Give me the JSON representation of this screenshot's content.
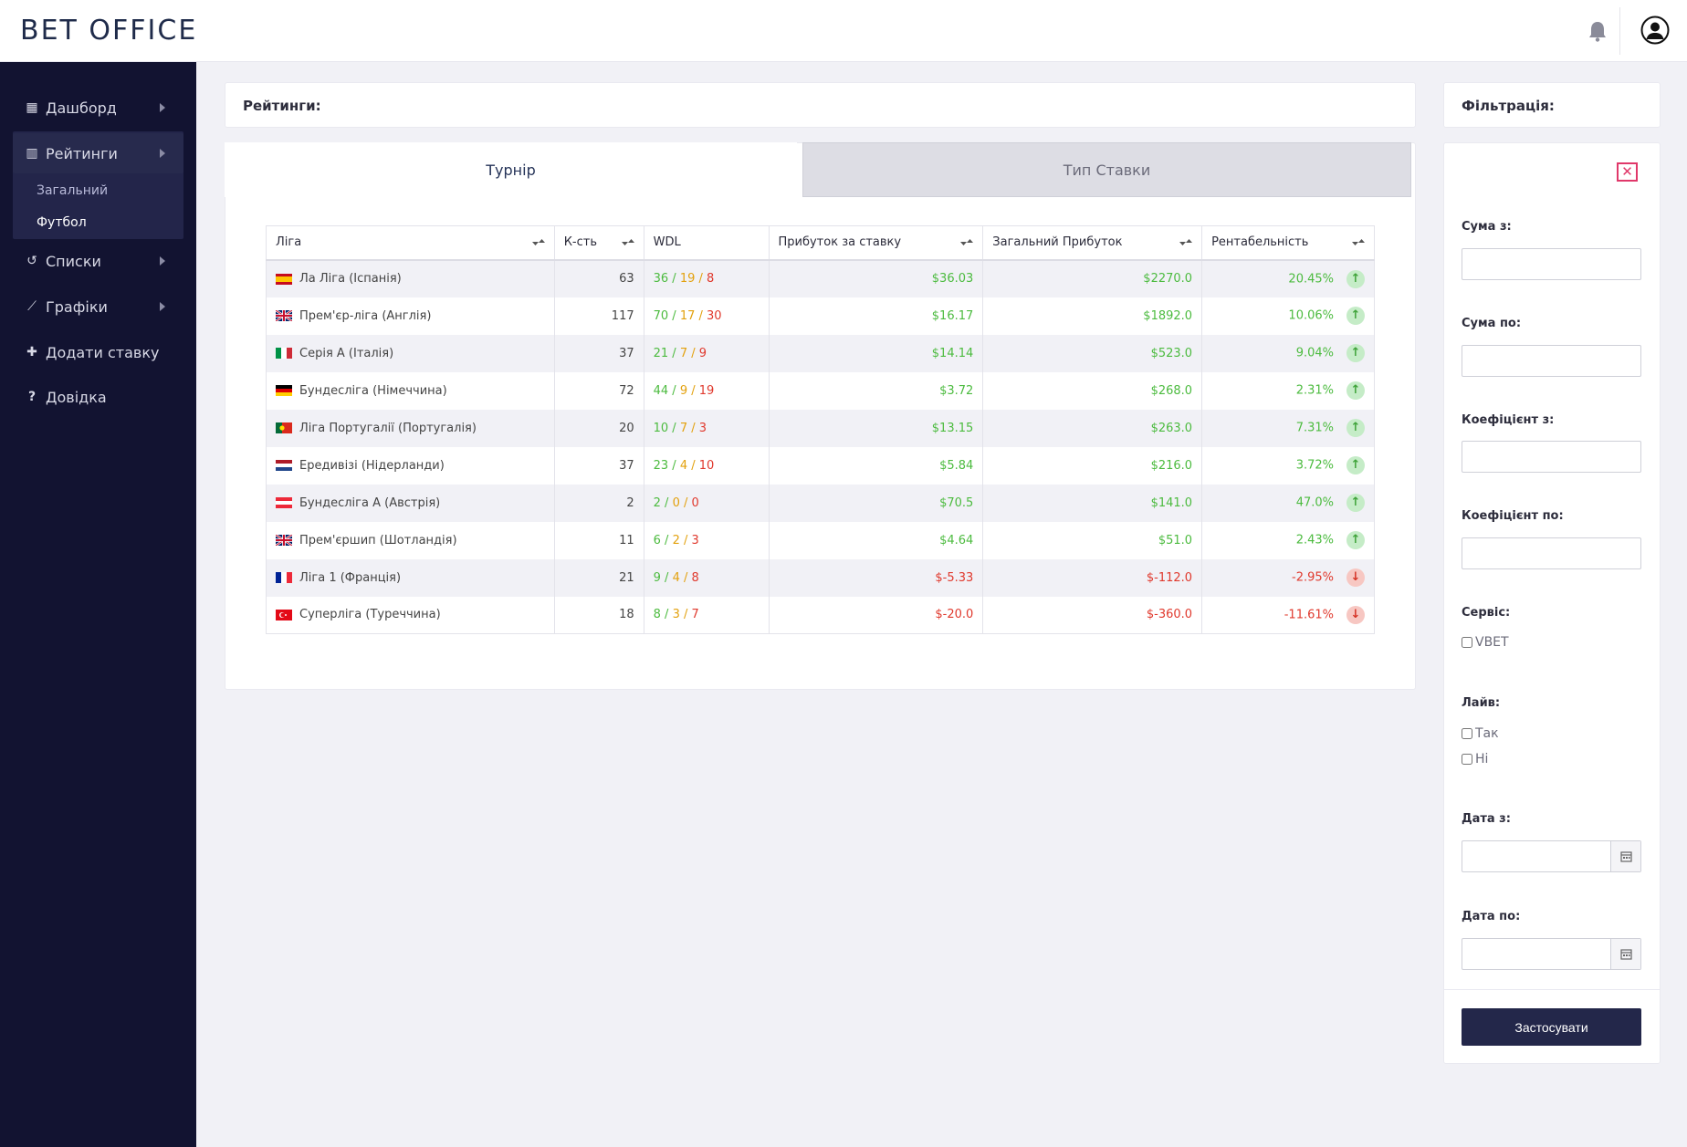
{
  "brand": "BET OFFICE",
  "sidebar": {
    "items": [
      {
        "label": "Дашборд",
        "icon": "dashboard-icon"
      },
      {
        "label": "Рейтинги",
        "icon": "bar-chart-icon"
      },
      {
        "label": "Списки",
        "icon": "history-icon"
      },
      {
        "label": "Графіки",
        "icon": "line-chart-icon"
      },
      {
        "label": "Додати ставку",
        "icon": "plus-icon"
      },
      {
        "label": "Довідка",
        "icon": "question-icon"
      }
    ],
    "sub_items": [
      "Загальний",
      "Футбол"
    ]
  },
  "ratings": {
    "title": "Рейтинги:",
    "tabs": [
      "Турнір",
      "Тип Ставки"
    ],
    "columns": [
      "Ліга",
      "К-сть",
      "WDL",
      "Прибуток за ставку",
      "Загальний Прибуток",
      "Рентабельність"
    ],
    "rows": [
      {
        "league": "Ла Ліга (Іспанія)",
        "flag": "es",
        "count": "63",
        "w": "36",
        "d": "19",
        "l": "8",
        "per_bet": "$36.03",
        "total": "$2270.0",
        "roi": "20.45%",
        "trend": "up"
      },
      {
        "league": "Прем'єр-ліга (Англія)",
        "flag": "gb",
        "count": "117",
        "w": "70",
        "d": "17",
        "l": "30",
        "per_bet": "$16.17",
        "total": "$1892.0",
        "roi": "10.06%",
        "trend": "up"
      },
      {
        "league": "Серія А (Італія)",
        "flag": "it",
        "count": "37",
        "w": "21",
        "d": "7",
        "l": "9",
        "per_bet": "$14.14",
        "total": "$523.0",
        "roi": "9.04%",
        "trend": "up"
      },
      {
        "league": "Бундесліга (Німеччина)",
        "flag": "de",
        "count": "72",
        "w": "44",
        "d": "9",
        "l": "19",
        "per_bet": "$3.72",
        "total": "$268.0",
        "roi": "2.31%",
        "trend": "up"
      },
      {
        "league": "Ліга Португалії (Португалія)",
        "flag": "pt",
        "count": "20",
        "w": "10",
        "d": "7",
        "l": "3",
        "per_bet": "$13.15",
        "total": "$263.0",
        "roi": "7.31%",
        "trend": "up"
      },
      {
        "league": "Ередивізі (Нідерланди)",
        "flag": "nl",
        "count": "37",
        "w": "23",
        "d": "4",
        "l": "10",
        "per_bet": "$5.84",
        "total": "$216.0",
        "roi": "3.72%",
        "trend": "up"
      },
      {
        "league": "Бундесліга А (Австрія)",
        "flag": "at",
        "count": "2",
        "w": "2",
        "d": "0",
        "l": "0",
        "per_bet": "$70.5",
        "total": "$141.0",
        "roi": "47.0%",
        "trend": "up"
      },
      {
        "league": "Прем'єршип (Шотландія)",
        "flag": "gb",
        "count": "11",
        "w": "6",
        "d": "2",
        "l": "3",
        "per_bet": "$4.64",
        "total": "$51.0",
        "roi": "2.43%",
        "trend": "up"
      },
      {
        "league": "Ліга 1 (Франція)",
        "flag": "fr",
        "count": "21",
        "w": "9",
        "d": "4",
        "l": "8",
        "per_bet": "$-5.33",
        "total": "$-112.0",
        "roi": "-2.95%",
        "trend": "down"
      },
      {
        "league": "Суперліга (Туреччина)",
        "flag": "tr",
        "count": "18",
        "w": "8",
        "d": "3",
        "l": "7",
        "per_bet": "$-20.0",
        "total": "$-360.0",
        "roi": "-11.61%",
        "trend": "down"
      }
    ]
  },
  "filter": {
    "title": "Фільтрація:",
    "sum_from": "Сума з:",
    "sum_to": "Сума по:",
    "coef_from": "Коефіцієнт з:",
    "coef_to": "Коефіцієнт по:",
    "service": "Сервіс:",
    "service_options": [
      "VBET"
    ],
    "live": "Лайв:",
    "live_options": [
      "Так",
      "Ні"
    ],
    "date_from": "Дата з:",
    "date_to": "Дата по:",
    "apply": "Застосувати"
  },
  "colors": {
    "sidebar_bg": "#121331",
    "positive": "#4cbb3f",
    "draw": "#e3a10e",
    "negative": "#e0392d",
    "apply_bg": "#23274a",
    "close": "#e0386a"
  }
}
